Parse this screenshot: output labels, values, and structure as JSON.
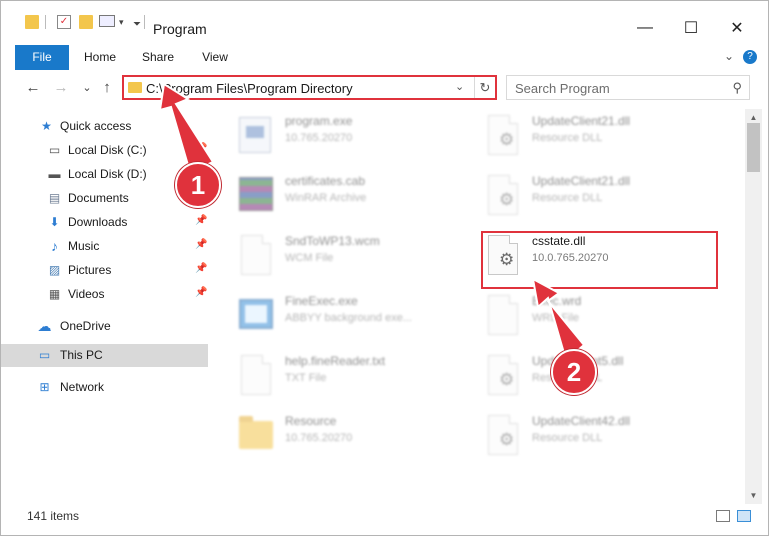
{
  "window": {
    "title": "Program",
    "minimize_glyph": "—",
    "maximize_glyph": "☐",
    "close_glyph": "✕"
  },
  "ribbon": {
    "tabs": [
      "File",
      "Home",
      "Share",
      "View"
    ],
    "expand_glyph": "⌄",
    "help_glyph": "?"
  },
  "nav": {
    "back_glyph": "←",
    "forward_glyph": "→",
    "recent_glyph": "⌄",
    "up_glyph": "↑"
  },
  "address": {
    "path": "C:\\Program Files\\Program Directory",
    "dropdown_glyph": "⌄",
    "refresh_glyph": "↻"
  },
  "search": {
    "placeholder": "Search Program",
    "icon_glyph": "⚲"
  },
  "sidebar": {
    "items": [
      {
        "label": "Quick access",
        "icon": "star-icon",
        "glyph": "★",
        "color": "#2d7dd2",
        "pinned": false
      },
      {
        "label": "Local Disk (C:)",
        "icon": "drive-icon",
        "glyph": "▭",
        "color": "#555555",
        "pinned": true
      },
      {
        "label": "Local Disk (D:)",
        "icon": "drive-icon",
        "glyph": "▬",
        "color": "#555555",
        "pinned": false
      },
      {
        "label": "Documents",
        "icon": "document-icon",
        "glyph": "▤",
        "color": "#6d7c93",
        "pinned": true
      },
      {
        "label": "Downloads",
        "icon": "download-icon",
        "glyph": "⬇",
        "color": "#2d7dd2",
        "pinned": true
      },
      {
        "label": "Music",
        "icon": "music-icon",
        "glyph": "♪",
        "color": "#2d7dd2",
        "pinned": true
      },
      {
        "label": "Pictures",
        "icon": "pictures-icon",
        "glyph": "▨",
        "color": "#4a7fb5",
        "pinned": true
      },
      {
        "label": "Videos",
        "icon": "video-icon",
        "glyph": "▦",
        "color": "#555555",
        "pinned": true
      },
      {
        "label": "OneDrive",
        "icon": "cloud-icon",
        "glyph": "☁",
        "color": "#2d7dd2",
        "pinned": false
      },
      {
        "label": "This PC",
        "icon": "computer-icon",
        "glyph": "▭",
        "color": "#2d7dd2",
        "pinned": false
      },
      {
        "label": "Network",
        "icon": "network-icon",
        "glyph": "⊞",
        "color": "#2d7dd2",
        "pinned": false
      }
    ],
    "pin_glyph": "📌"
  },
  "files": [
    {
      "name": "program.exe",
      "meta": "10.765.20270",
      "icon": "program-icon",
      "blurred": true
    },
    {
      "name": "UpdateClient21.dll",
      "meta": "Resource DLL",
      "icon": "dll-icon",
      "blurred": true
    },
    {
      "name": "certificates.cab",
      "meta": "WinRAR Archive",
      "icon": "archive-icon",
      "blurred": true
    },
    {
      "name": "UpdateClient21.dll",
      "meta": "Resource DLL",
      "icon": "dll-icon",
      "blurred": true
    },
    {
      "name": "SndToWP13.wcm",
      "meta": "WCM File",
      "icon": "file-icon",
      "blurred": true
    },
    {
      "name": "csstate.dll",
      "meta": "10.0.765.20270",
      "icon": "dll-icon",
      "blurred": false
    },
    {
      "name": "FineExec.exe",
      "meta": "ABBYY background exe...",
      "icon": "exe-icon",
      "blurred": true
    },
    {
      "name": "Exec.wrd",
      "meta": "WRD File",
      "icon": "file-icon",
      "blurred": true
    },
    {
      "name": "help.fineReader.txt",
      "meta": "TXT File",
      "icon": "text-file-icon",
      "blurred": true
    },
    {
      "name": "UpdateClient5.dll",
      "meta": "Resource DLL",
      "icon": "dll-icon",
      "blurred": true
    },
    {
      "name": "Resource",
      "meta": "10.765.20270",
      "icon": "folder-icon",
      "blurred": true
    },
    {
      "name": "UpdateClient42.dll",
      "meta": "Resource DLL",
      "icon": "dll-icon",
      "blurred": true
    }
  ],
  "status": {
    "item_count": "141 items"
  },
  "callouts": [
    "1",
    "2"
  ],
  "colors": {
    "accent": "#1979ca",
    "highlight_red": "#e0323c",
    "selected_nav": "#d9d9d9"
  }
}
